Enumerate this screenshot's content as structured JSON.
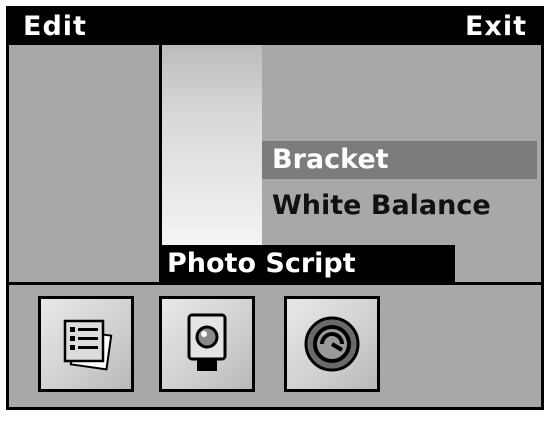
{
  "topbar": {
    "left_softkey": "Edit",
    "right_softkey": "Exit"
  },
  "menu": {
    "items": [
      {
        "label": "Bracket",
        "selected": true
      },
      {
        "label": "White Balance",
        "selected": false
      }
    ],
    "title": "Photo Script"
  },
  "toolbar": {
    "buttons": [
      {
        "icon": "document-list-icon"
      },
      {
        "icon": "camera-icon"
      },
      {
        "icon": "circular-dial-icon"
      }
    ]
  },
  "colors": {
    "background": "#a8a8a8",
    "bar": "#000000",
    "selected_item": "#7c7c7c"
  }
}
